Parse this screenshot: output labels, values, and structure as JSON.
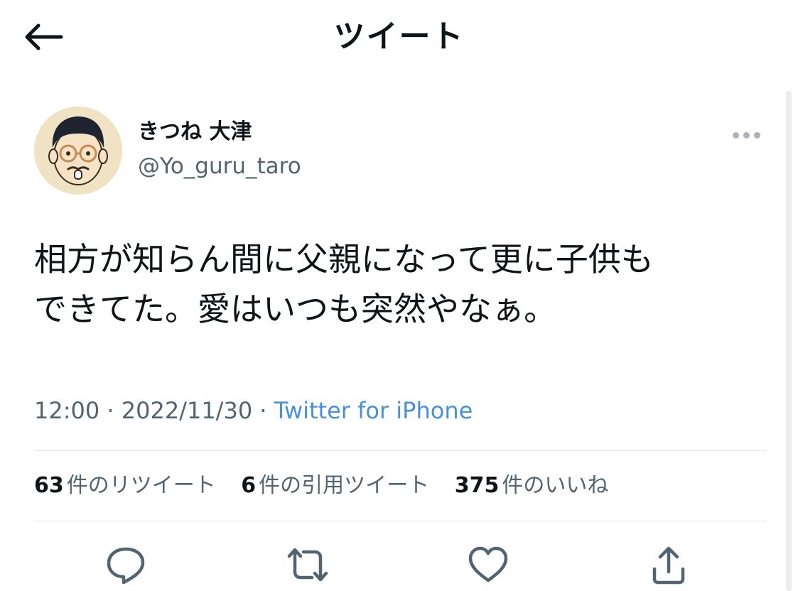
{
  "header": {
    "title": "ツイート",
    "back_icon": "arrow-left-icon"
  },
  "tweet": {
    "author": {
      "display_name": "きつね 大津",
      "handle": "@Yo_guru_taro"
    },
    "text": "相方が知らん間に父親になって更に子供も\nできてた。愛はいつも突然やなぁ。",
    "time": "12:00",
    "date": "2022/11/30",
    "separator": "·",
    "source": "Twitter for iPhone",
    "stats": {
      "retweets_count": "63",
      "retweets_label": "件のリツイート",
      "quotes_count": "6",
      "quotes_label": "件の引用ツイート",
      "likes_count": "375",
      "likes_label": "件のいいね"
    },
    "actions": [
      "reply-icon",
      "retweet-icon",
      "like-icon",
      "share-icon"
    ]
  },
  "colors": {
    "text_primary": "#0f1419",
    "text_secondary": "#536471",
    "link": "#4a90d9",
    "divider": "#e3e6e8"
  }
}
